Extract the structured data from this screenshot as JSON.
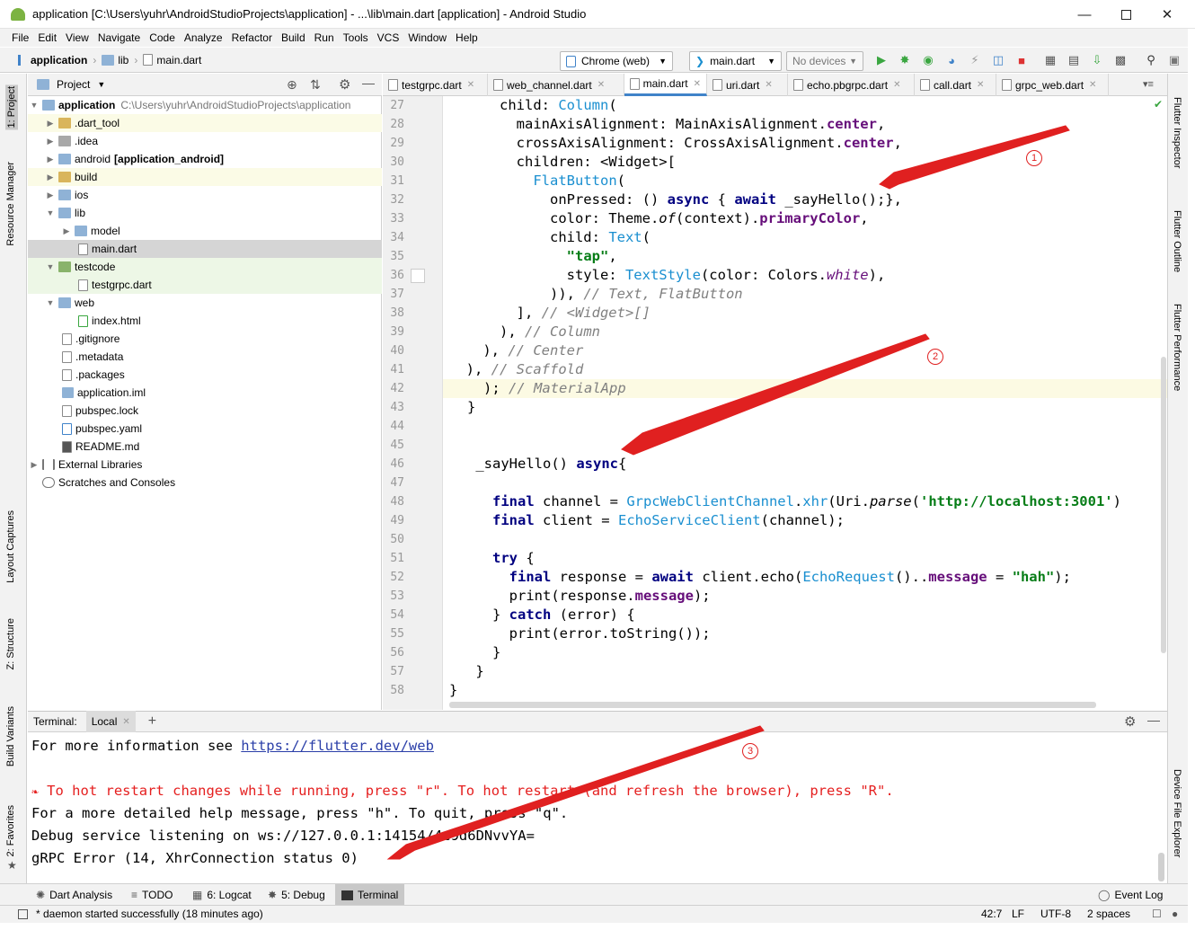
{
  "window": {
    "title": "application [C:\\Users\\yuhr\\AndroidStudioProjects\\application] - ...\\lib\\main.dart [application] - Android Studio"
  },
  "menu": [
    "File",
    "Edit",
    "View",
    "Navigate",
    "Code",
    "Analyze",
    "Refactor",
    "Build",
    "Run",
    "Tools",
    "VCS",
    "Window",
    "Help"
  ],
  "breadcrumb": [
    "application",
    "lib",
    "main.dart"
  ],
  "toolbar": {
    "device_target": "Chrome (web)",
    "run_config": "main.dart",
    "devices": "No devices"
  },
  "left_tabs": [
    "1: Project",
    "Resource Manager",
    "Layout Captures",
    "Z: Structure",
    "Build Variants",
    "2: Favorites"
  ],
  "right_tabs": [
    "Flutter Inspector",
    "Flutter Outline",
    "Flutter Performance",
    "Device File Explorer"
  ],
  "project": {
    "header": "Project",
    "items": [
      {
        "label": "application",
        "extra": "C:\\Users\\yuhr\\AndroidStudioProjects\\application"
      },
      {
        "label": ".dart_tool"
      },
      {
        "label": ".idea"
      },
      {
        "label": "android",
        "extra": "[application_android]"
      },
      {
        "label": "build"
      },
      {
        "label": "ios"
      },
      {
        "label": "lib"
      },
      {
        "label": "model"
      },
      {
        "label": "main.dart"
      },
      {
        "label": "testcode"
      },
      {
        "label": "testgrpc.dart"
      },
      {
        "label": "web"
      },
      {
        "label": "index.html"
      },
      {
        "label": ".gitignore"
      },
      {
        "label": ".metadata"
      },
      {
        "label": ".packages"
      },
      {
        "label": "application.iml"
      },
      {
        "label": "pubspec.lock"
      },
      {
        "label": "pubspec.yaml"
      },
      {
        "label": "README.md"
      },
      {
        "label": "External Libraries"
      },
      {
        "label": "Scratches and Consoles"
      }
    ]
  },
  "editor_tabs": [
    "testgrpc.dart",
    "web_channel.dart",
    "main.dart",
    "uri.dart",
    "echo.pbgrpc.dart",
    "call.dart",
    "grpc_web.dart"
  ],
  "editor": {
    "line_numbers": [
      "27",
      "28",
      "29",
      "30",
      "31",
      "32",
      "33",
      "34",
      "35",
      "36",
      "37",
      "38",
      "39",
      "40",
      "41",
      "42",
      "43",
      "44",
      "45",
      "46",
      "47",
      "48",
      "49",
      "50",
      "51",
      "52",
      "53",
      "54",
      "55",
      "56",
      "57",
      "58"
    ],
    "code": {
      "l27a": "      child: ",
      "l27b": "Column",
      "l27c": "(",
      "l28a": "        mainAxisAlignment: MainAxisAlignment.",
      "l28b": "center",
      ",": ",",
      "l29a": "        crossAxisAlignment: CrossAxisAlignment.",
      "l29b": "center",
      "l30": "        children: <Widget>[",
      "l31a": "          ",
      "l31b": "FlatButton",
      "l31c": "(",
      "l32a": "            onPressed: () ",
      "l32b": "async",
      " l32c": " { ",
      "l32d": "await",
      "l32e": " _sayHello();},",
      "l33a": "            color: Theme.",
      "l33b": "of",
      "l33c": "(context).",
      "l33d": "primaryColor",
      "l34a": "            child: ",
      "l34b": "Text",
      "l34c": "(",
      "l35a": "              ",
      "l35b": "\"tap\"",
      "l36a": "              style: ",
      "l36b": "TextStyle",
      "l36c": "(color: Colors.",
      "l36d": "white",
      "l36e": "),",
      "l37a": "            )), ",
      "l37b": "// Text, FlatButton",
      "l38a": "        ], ",
      "l38b": "// <Widget>[]",
      "l39a": "      ), ",
      "l39b": "// Column",
      "l40a": "    ), ",
      "l40b": "// Center",
      "l41a": "  ), ",
      "l41b": "// Scaffold",
      "l42a": "); ",
      "l42b": "// MaterialApp",
      "l43": "}",
      "l46a": " _sayHello() ",
      "l46b": "async",
      "l46c": "{",
      "l48a": "   final",
      "l48b": " channel = ",
      "l48c": "GrpcWebClientChannel",
      "l48d": ".",
      "l48e": "xhr",
      "l48f": "(Uri.",
      "l48g": "parse",
      "l48h": "(",
      "l48i": "'http://localhost:3001'",
      ")": ")",
      "l49a": "   final",
      "l49b": " client = ",
      "l49c": "EchoServiceClient",
      "l49d": "(channel);",
      "l51a": "   try",
      " l51b": " {",
      "l52a": "     final",
      "l52b": " response = ",
      "l52c": "await",
      "l52d": " client.echo(",
      "l52e": "EchoRequest",
      "l52f": "()..",
      "l52g": "message",
      "l52h": " = ",
      "l52i": "\"hah\"",
      "l52j": ");",
      "l53a": "     print(response.",
      "l53b": "message",
      "l53c": ");",
      "l54a": "   } ",
      "l54b": "catch",
      " l54c": " (error) {",
      "l55": "     print(error.toString());",
      "l56": "   }",
      "l57": " }",
      "l58": "}"
    }
  },
  "terminal": {
    "label": "Terminal:",
    "tab": "Local",
    "lines": [
      {
        "text": "For more information see ",
        "link": "https://flutter.dev/web"
      },
      {
        "text": ""
      },
      {
        "text": " To hot restart changes while running, press \"r\". To hot restart (and refresh the browser), press \"R\"."
      },
      {
        "text": "For a more detailed help message, press \"h\". To quit, press \"q\"."
      },
      {
        "text": "Debug service listening on ws://127.0.0.1:14154/4c9d6DNvvYA="
      },
      {
        "text": "gRPC Error (14, XhrConnection status 0)"
      }
    ]
  },
  "bottom_tabs": [
    "Dart Analysis",
    "TODO",
    "6: Logcat",
    "5: Debug",
    "Terminal",
    "Event Log"
  ],
  "status": {
    "message": "* daemon started successfully (18 minutes ago)",
    "position": "42:7",
    "line_sep": "LF",
    "encoding": "UTF-8",
    "indent": "2 spaces"
  },
  "annotations": [
    "1",
    "2",
    "3"
  ],
  "colors": {
    "accent": "#4083c9",
    "annotation": "#e02020",
    "keyword": "#000080",
    "class": "#1a8fd0",
    "string": "#067d17",
    "comment": "#808080",
    "field": "#660e7a"
  }
}
